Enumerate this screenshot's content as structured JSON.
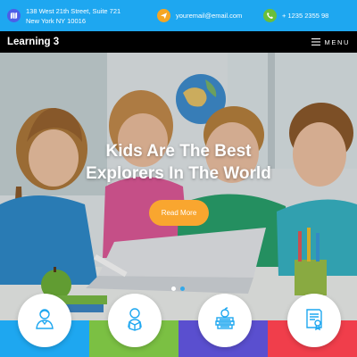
{
  "topbar": {
    "address_line1": "138 West 21th Street, Suite 721",
    "address_line2": "New York NY 10016",
    "email": "youremail@email.com",
    "phone": "+ 1235 2355 98",
    "icons": [
      "map-icon",
      "paper-plane-icon",
      "phone-icon"
    ],
    "background": "#1ea7f0"
  },
  "nav": {
    "brand": "Learning 3",
    "menu_label": "MENU",
    "menu_icon": "hamburger-icon"
  },
  "hero": {
    "headline_line1": "Kids Are The Best",
    "headline_line2": "Explorers In The World",
    "cta_label": "Read More",
    "cta_color": "#f9a62f",
    "slides": 2,
    "active_slide": 1
  },
  "features": [
    {
      "icon": "teacher-icon",
      "strip_color": "#1ea7f0"
    },
    {
      "icon": "student-reading-icon",
      "strip_color": "#7bc043"
    },
    {
      "icon": "books-apple-icon",
      "strip_color": "#5a4fcf"
    },
    {
      "icon": "certificate-icon",
      "strip_color": "#f03e4b"
    }
  ]
}
